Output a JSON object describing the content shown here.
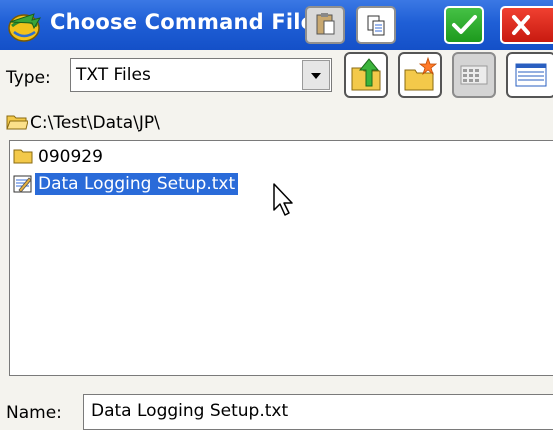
{
  "window": {
    "title": "Choose Command File"
  },
  "filter": {
    "label": "Type:",
    "value": "TXT Files"
  },
  "path": "C:\\Test\\Data\\JP\\",
  "files": [
    {
      "name": "090929",
      "kind": "folder",
      "selected": false
    },
    {
      "name": "Data Logging Setup.txt",
      "kind": "text-file",
      "selected": true
    }
  ],
  "name_field": {
    "label": "Name:",
    "value": "Data Logging Setup.txt"
  },
  "icons": {
    "app": "globe-arrow-icon",
    "paste": "paste-icon",
    "copy": "copy-icon",
    "ok": "checkmark-icon",
    "close": "close-icon",
    "up": "folder-up-icon",
    "new_folder": "new-folder-icon",
    "list_view": "list-view-icon",
    "details_view": "details-view-icon"
  },
  "colors": {
    "titlebar": "#1f5fd6",
    "selection": "#2a6bd9",
    "ok_button": "#2aa82a",
    "close_button": "#e0281c"
  }
}
